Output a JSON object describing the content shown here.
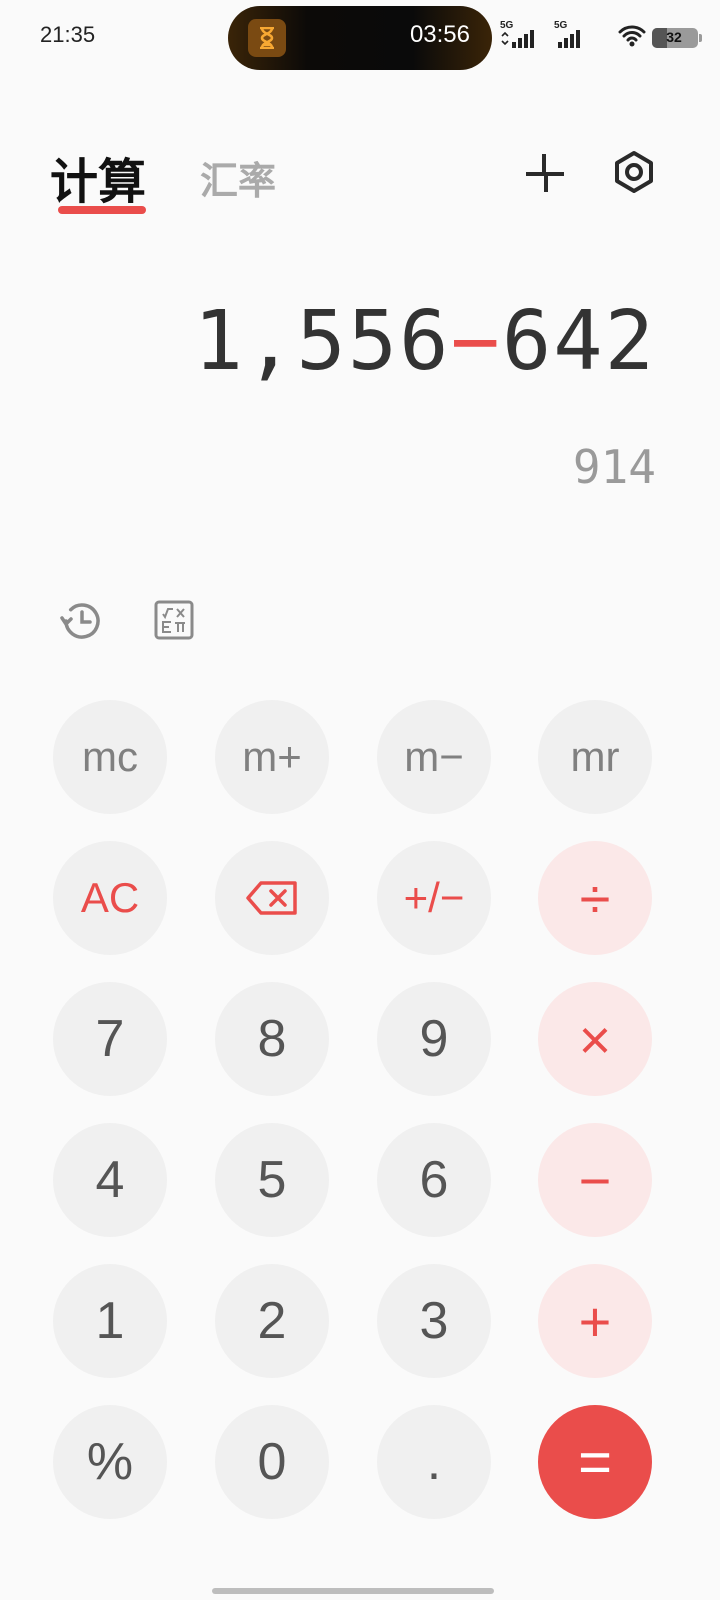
{
  "status_bar": {
    "time": "21:35",
    "timer": "03:56",
    "signal1_label": "5G",
    "signal2_label": "5G",
    "battery": "32",
    "battery_level": 0.32
  },
  "tabs": {
    "calculator": "计算",
    "exchange_rate": "汇率"
  },
  "display": {
    "expr_left": "1,556",
    "expr_operator": "−",
    "expr_right": "642",
    "result": "914"
  },
  "keys": {
    "mc": "mc",
    "mplus": "m+",
    "mminus": "m−",
    "mr": "mr",
    "ac": "AC",
    "sign": "+/−",
    "divide": "÷",
    "seven": "7",
    "eight": "8",
    "nine": "9",
    "multiply": "×",
    "four": "4",
    "five": "5",
    "six": "6",
    "minus": "−",
    "one": "1",
    "two": "2",
    "three": "3",
    "plus": "+",
    "percent": "%",
    "zero": "0",
    "dot": ".",
    "equals": "="
  },
  "colors": {
    "accent": "#ea4d4b",
    "key_bg": "#f0f0f0",
    "op_key_bg": "#fbe8e8"
  },
  "icons": {
    "timer": "hourglass-icon",
    "collapse": "collapse-icon",
    "settings": "settings-icon",
    "history": "history-icon",
    "scientific": "scientific-icon",
    "backspace": "backspace-icon"
  }
}
